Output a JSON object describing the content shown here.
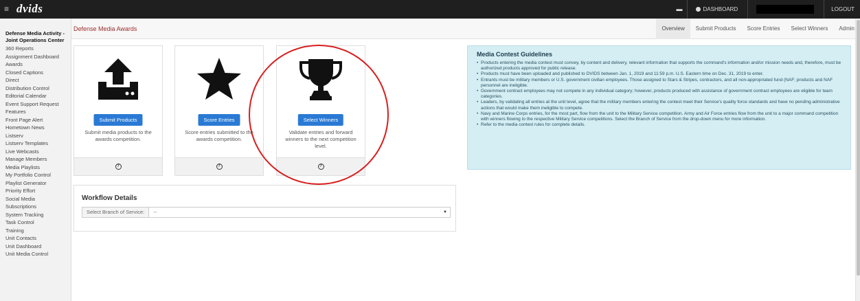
{
  "topbar": {
    "menu_icon": "≡",
    "logo": "dvids",
    "chat_icon": "▬",
    "dashboard": "DASHBOARD",
    "logout": "LOGOUT"
  },
  "sidebar": {
    "org": "Defense Media Activity - Joint Operations Center",
    "items": [
      "360 Reports",
      "Assignment Dashboard",
      "Awards",
      "Closed Captions",
      "Direct",
      "Distribution Control",
      "Editorial Calendar",
      "Event Support Request",
      "Features",
      "Front Page Alert",
      "Hometown News",
      "Listserv",
      "Listserv Templates",
      "Live Webcasts",
      "Manage Members",
      "Media Playlists",
      "My Portfolio Control",
      "Playlist Generator",
      "Priority Effort",
      "Social Media",
      "Subscriptions",
      "System Tracking",
      "Task Control",
      "Training",
      "Unit Contacts",
      "Unit Dashboard",
      "Unit Media Control"
    ]
  },
  "subbar": {
    "title": "Defense Media Awards",
    "tabs": [
      "Overview",
      "Submit Products",
      "Score Entries",
      "Select Winners",
      "Admin"
    ]
  },
  "cards": [
    {
      "button": "Submit Products",
      "desc": "Submit media products to the awards competition.",
      "icon": "upload-icon"
    },
    {
      "button": "Score Entries",
      "desc": "Score entries submitted to the awards competition.",
      "icon": "star-icon"
    },
    {
      "button": "Select Winners",
      "desc": "Validate entries and forward winners to the next competition level.",
      "icon": "trophy-icon"
    }
  ],
  "help_glyph": "?",
  "workflow": {
    "title": "Workflow Details",
    "branch_label": "Select Branch of Service:",
    "branch_value": "--"
  },
  "guidelines": {
    "title": "Media Contest Guidelines",
    "items": [
      "Products entering the media contest must convey, by content and delivery, relevant information that supports the command's information and/or mission needs and, therefore, must be authorized products approved for public release.",
      "Products must have been uploaded and published to DVIDS between Jan. 1, 2019 and 11:59 p.m. U.S. Eastern time on Dec. 31, 2019 to enter.",
      "Entrants must be military members or U.S. government civilian employees. Those assigned to Stars & Stripes, contractors, and all non-appropriated fund (NAF; products and NAF personnel are ineligible.",
      "Government contract employees may not compete in any individual category; however, products produced with assistance of government contract employees are eligible for team categories.",
      "Leaders, by validating all entries at the unit level, agree that the military members entering the contest meet their Service's quality force standards and have no pending administrative actions that would make them ineligible to compete.",
      "Navy and Marine Corps entries, for the most part, flow from the unit to the Military Service competition. Army and Air Force entries flow from the unit to a major command competition with winners flowing to the respective Military Service competitions. Select the Branch of Service from the drop-down menu for more information.",
      "Refer to the media contest rules for complete details."
    ]
  },
  "colors": {
    "topbar": "#1f1f1f",
    "accent_button": "#2a7ad5",
    "title_red": "#9b2c2c",
    "guidelines_bg": "#d4eef4",
    "annotation": "#d81c1c"
  }
}
